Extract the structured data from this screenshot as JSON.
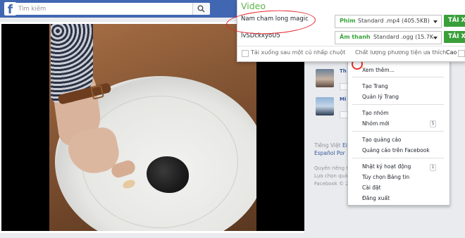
{
  "facebook": {
    "logo": "f",
    "search_placeholder": "Tìm kiếm",
    "sidebar": {
      "friends": [
        {
          "name_fragment": "Th"
        },
        {
          "name_fragment": "Mi"
        }
      ],
      "languages": {
        "current": "Tiếng Việt",
        "lines": [
          "Ei",
          "Español",
          "Por"
        ]
      },
      "footer": [
        "Quyền riêng t",
        "Lựa chọn quả",
        "Facebook © 2"
      ]
    },
    "menu": {
      "see_more": "Xem thêm...",
      "items": [
        "Tạo Trang",
        "Quản lý Trang",
        "Tạo nhóm",
        "Nhóm mới",
        "Tạo quảng cáo",
        "Quảng cáo trên Facebook",
        "Nhật ký hoạt động",
        "Tùy chọn Bảng tin",
        "Cài đặt",
        "Đăng xuất"
      ],
      "badges": {
        "new_groups": "5",
        "activity_log": "1"
      }
    }
  },
  "downloader": {
    "title": "Video",
    "video_title": "Nam cham long magic",
    "video_id": "lvSDckxyoU5",
    "video_option": {
      "kind": "Phim",
      "value": "Standard .mp4 (405.5KB)"
    },
    "audio_option": {
      "kind": "Âm thanh",
      "value": "Standard .ogg (15.7K"
    },
    "download_label": "TẢI XU",
    "auto_download_label": "Tải xuống sau một cú nhấp chuột",
    "quality_label": "Chất lượng phương tiện ưa thích",
    "quality_value": "Cao",
    "colors": {
      "accent": "#5bb54a",
      "button": "#3a9f3a",
      "highlight_circle": "#e4222a",
      "facebook_blue": "#4267b2"
    }
  }
}
